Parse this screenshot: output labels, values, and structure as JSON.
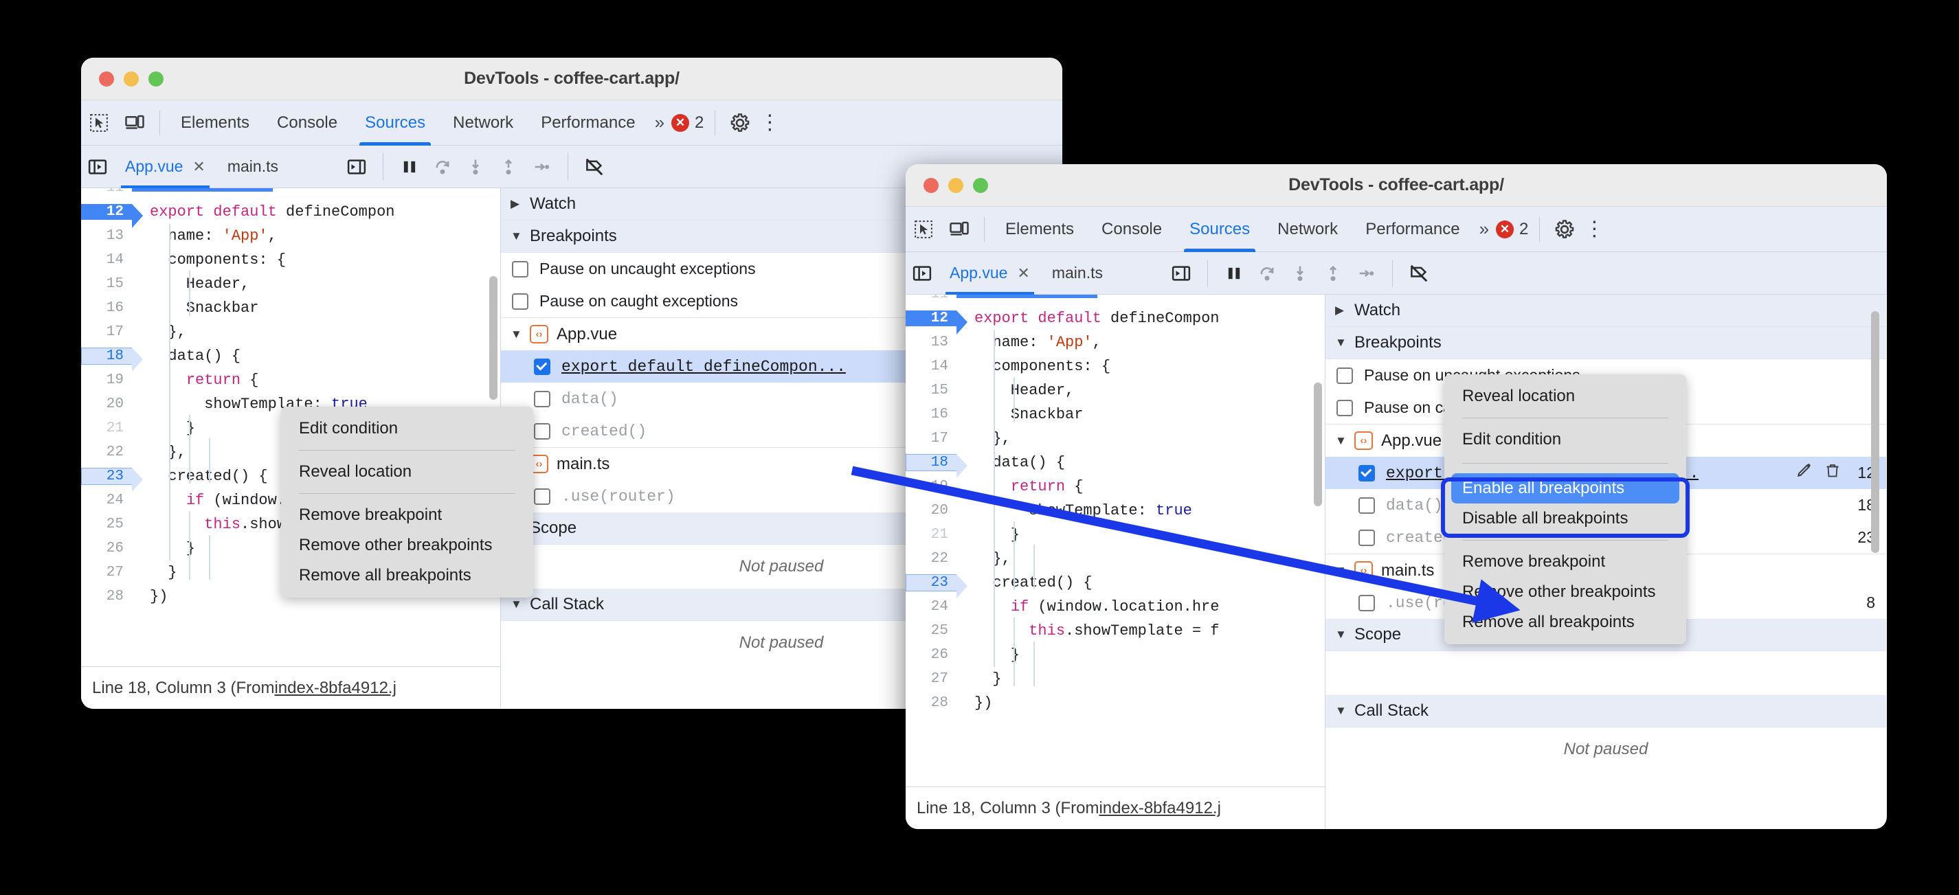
{
  "window1": {
    "title": "DevTools - coffee-cart.app/",
    "traffic": [
      "close",
      "minimize",
      "maximize"
    ],
    "toolbar": {
      "inspect_icon": "inspect-element-icon",
      "device_icon": "device-toolbar-icon",
      "tabs": [
        {
          "label": "Elements",
          "active": false
        },
        {
          "label": "Console",
          "active": false
        },
        {
          "label": "Sources",
          "active": true
        },
        {
          "label": "Network",
          "active": false
        },
        {
          "label": "Performance",
          "active": false
        }
      ],
      "overflow_label": "»",
      "error_count": "2",
      "error_icon": "error-circle-icon",
      "settings_icon": "gear-icon",
      "more_icon": "kebab-menu-icon"
    },
    "sources_tabs": {
      "navigator_icon": "show-navigator-icon",
      "files": [
        {
          "label": "App.vue",
          "active": true,
          "closeable": true
        },
        {
          "label": "main.ts",
          "active": false,
          "closeable": false
        }
      ],
      "close_glyph": "✕",
      "debug_buttons": [
        "show-debugger-icon",
        "pause-resume-icon",
        "step-over-icon",
        "step-into-icon",
        "step-out-icon",
        "step-icon",
        "deactivate-breakpoints-icon"
      ]
    },
    "code": {
      "first_partial_line": "11",
      "lines": [
        {
          "n": "12",
          "text": "export default defineCompon",
          "state": "active"
        },
        {
          "n": "13",
          "text": "  name: 'App',",
          "state": "none"
        },
        {
          "n": "14",
          "text": "  components: {",
          "state": "none"
        },
        {
          "n": "15",
          "text": "    Header,",
          "state": "none"
        },
        {
          "n": "16",
          "text": "    Snackbar",
          "state": "none"
        },
        {
          "n": "17",
          "text": "  },",
          "state": "none"
        },
        {
          "n": "18",
          "text": "  data() {",
          "state": "dim-bp"
        },
        {
          "n": "19",
          "text": "    return {",
          "state": "none"
        },
        {
          "n": "20",
          "text": "      showTemplate: true",
          "state": "none"
        },
        {
          "n": "21",
          "text": "    }",
          "state": "faded"
        },
        {
          "n": "22",
          "text": "  },",
          "state": "none"
        },
        {
          "n": "23",
          "text": "  created() {",
          "state": "dim-bp"
        },
        {
          "n": "24",
          "text": "    if (window.location.hre",
          "state": "none"
        },
        {
          "n": "25",
          "text": "      this.showTemplate = f",
          "state": "none"
        },
        {
          "n": "26",
          "text": "    }",
          "state": "none"
        },
        {
          "n": "27",
          "text": "  }",
          "state": "none"
        },
        {
          "n": "28",
          "text": "})",
          "state": "none"
        }
      ]
    },
    "statusbar": {
      "prefix": "Line 18, Column 3 (From ",
      "link": "index-8bfa4912.j"
    },
    "debugger": {
      "watch_label": "Watch",
      "breakpoints_label": "Breakpoints",
      "pause_uncaught": "Pause on uncaught exceptions",
      "pause_caught": "Pause on caught exceptions",
      "groups": [
        {
          "file": "App.vue",
          "icon": "vue-file-icon",
          "rows": [
            {
              "label": "export default defineCompon...",
              "checked": true,
              "selected": true,
              "lineno": ""
            },
            {
              "label": "data()",
              "checked": false,
              "selected": false,
              "lineno": ""
            },
            {
              "label": "created()",
              "checked": false,
              "selected": false,
              "lineno": ""
            }
          ]
        },
        {
          "file": "main.ts",
          "icon": "ts-file-icon",
          "rows": [
            {
              "label": ".use(router)",
              "checked": false,
              "selected": false,
              "lineno": ""
            }
          ]
        }
      ],
      "scope_label": "Scope",
      "scope_value": "Not paused",
      "callstack_label": "Call Stack",
      "callstack_value": "Not paused"
    },
    "context_menu": {
      "items": [
        {
          "label": "Edit condition",
          "type": "item"
        },
        {
          "label": "",
          "type": "sep"
        },
        {
          "label": "Reveal location",
          "type": "item"
        },
        {
          "label": "",
          "type": "sep"
        },
        {
          "label": "Remove breakpoint",
          "type": "item"
        },
        {
          "label": "Remove other breakpoints",
          "type": "item"
        },
        {
          "label": "Remove all breakpoints",
          "type": "item"
        }
      ]
    }
  },
  "window2": {
    "title": "DevTools - coffee-cart.app/",
    "toolbar": {
      "tabs": [
        {
          "label": "Elements",
          "active": false
        },
        {
          "label": "Console",
          "active": false
        },
        {
          "label": "Sources",
          "active": true
        },
        {
          "label": "Network",
          "active": false
        },
        {
          "label": "Performance",
          "active": false
        }
      ],
      "overflow_label": "»",
      "error_count": "2"
    },
    "sources_tabs": {
      "files": [
        {
          "label": "App.vue",
          "active": true,
          "closeable": true
        },
        {
          "label": "main.ts",
          "active": false,
          "closeable": false
        }
      ],
      "close_glyph": "✕"
    },
    "code": {
      "first_partial_line": "11",
      "lines": [
        {
          "n": "12",
          "text": "export default defineCompon",
          "state": "active"
        },
        {
          "n": "13",
          "text": "  name: 'App',",
          "state": "none"
        },
        {
          "n": "14",
          "text": "  components: {",
          "state": "none"
        },
        {
          "n": "15",
          "text": "    Header,",
          "state": "none"
        },
        {
          "n": "16",
          "text": "    Snackbar",
          "state": "none"
        },
        {
          "n": "17",
          "text": "  },",
          "state": "none"
        },
        {
          "n": "18",
          "text": "  data() {",
          "state": "dim-bp"
        },
        {
          "n": "19",
          "text": "    return {",
          "state": "none"
        },
        {
          "n": "20",
          "text": "      showTemplate: true",
          "state": "none"
        },
        {
          "n": "21",
          "text": "    }",
          "state": "faded"
        },
        {
          "n": "22",
          "text": "  },",
          "state": "none"
        },
        {
          "n": "23",
          "text": "  created() {",
          "state": "dim-bp"
        },
        {
          "n": "24",
          "text": "    if (window.location.hre",
          "state": "none"
        },
        {
          "n": "25",
          "text": "      this.showTemplate = f",
          "state": "none"
        },
        {
          "n": "26",
          "text": "    }",
          "state": "none"
        },
        {
          "n": "27",
          "text": "  }",
          "state": "none"
        },
        {
          "n": "28",
          "text": "})",
          "state": "none"
        }
      ]
    },
    "statusbar": {
      "prefix": "Line 18, Column 3 (From ",
      "link": "index-8bfa4912.j"
    },
    "debugger": {
      "watch_label": "Watch",
      "breakpoints_label": "Breakpoints",
      "pause_uncaught": "Pause on uncaught exceptions",
      "pause_caught": "Pause on caught exceptions",
      "groups": [
        {
          "file": "App.vue",
          "icon": "vue-file-icon",
          "rows": [
            {
              "label": "export default defineComponent...",
              "checked": true,
              "selected": true,
              "lineno": "12",
              "edit_icon": "pencil-icon",
              "delete_icon": "trash-icon"
            },
            {
              "label": "data()",
              "checked": false,
              "selected": false,
              "lineno": "18"
            },
            {
              "label": "created()",
              "checked": false,
              "selected": false,
              "lineno": "23"
            }
          ]
        },
        {
          "file": "main.ts",
          "icon": "ts-file-icon",
          "rows": [
            {
              "label": ".use(router)",
              "checked": false,
              "selected": false,
              "lineno": "8"
            }
          ]
        }
      ],
      "scope_label": "Scope",
      "callstack_label": "Call Stack",
      "callstack_value": "Not paused"
    },
    "context_menu": {
      "items": [
        {
          "label": "Reveal location",
          "type": "item"
        },
        {
          "label": "",
          "type": "sep"
        },
        {
          "label": "Edit condition",
          "type": "item"
        },
        {
          "label": "",
          "type": "sep2"
        },
        {
          "label": "Enable all breakpoints",
          "type": "highlight"
        },
        {
          "label": "Disable all breakpoints",
          "type": "item"
        },
        {
          "label": "",
          "type": "sep"
        },
        {
          "label": "Remove breakpoint",
          "type": "item"
        },
        {
          "label": "Remove other breakpoints",
          "type": "item"
        },
        {
          "label": "Remove all breakpoints",
          "type": "item"
        }
      ],
      "highlight_color": "#1a38e8",
      "selected_color": "#4c8df6"
    }
  },
  "annotation": {
    "arrow_color": "#1a38e8",
    "description": "arrow pointing from window-1 context menu to window-2 Enable all breakpoints item"
  }
}
